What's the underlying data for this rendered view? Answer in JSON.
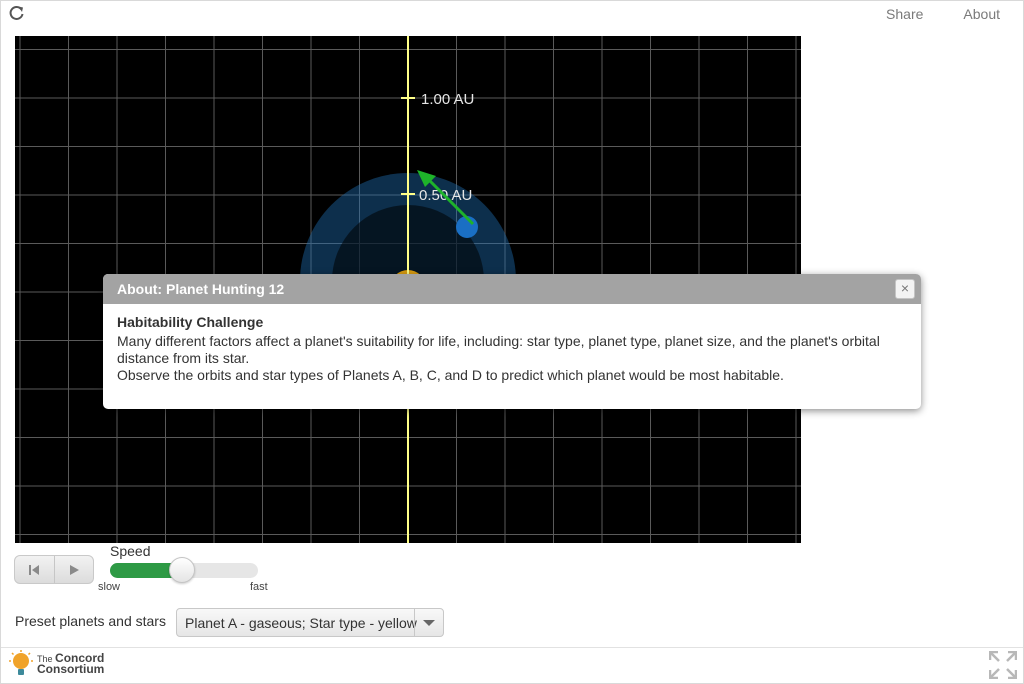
{
  "topnav": {
    "share": "Share",
    "about": "About"
  },
  "icons": {
    "reload": "reload-icon",
    "fullscreen": "fullscreen-icon",
    "play": "play-icon",
    "reset": "skip-back-icon",
    "close": "close-icon",
    "logo": "lightbulb-icon"
  },
  "simulation": {
    "axis_labels": [
      "1.00 AU",
      "0.50 AU"
    ],
    "orbit_color": "#1f6fb4",
    "axis_color": "#ffff88",
    "velocity_arrow_color": "#1eb32a",
    "star_color": "#d99c10"
  },
  "controls": {
    "speed_label": "Speed",
    "speed_value": 0.48,
    "slow_label": "slow",
    "fast_label": "fast",
    "preset_label": "Preset planets and stars",
    "preset_value": "Planet A - gaseous; Star type - yellow"
  },
  "footer": {
    "logo_line1": "The",
    "logo_line2": "Concord",
    "logo_line3": "Consortium"
  },
  "dialog": {
    "title": "About: Planet Hunting 12",
    "heading": "Habitability Challenge",
    "paragraph1": "Many different factors affect a planet's suitability for life, including: star type, planet type, planet size, and the planet's orbital distance from its star.",
    "paragraph2": "Observe the orbits and star types of Planets A, B, C, and D to predict which planet would be most habitable.",
    "close": "×"
  },
  "colors": {
    "accent_green": "#2e9a45",
    "dialog_header": "#a3a3a3"
  }
}
